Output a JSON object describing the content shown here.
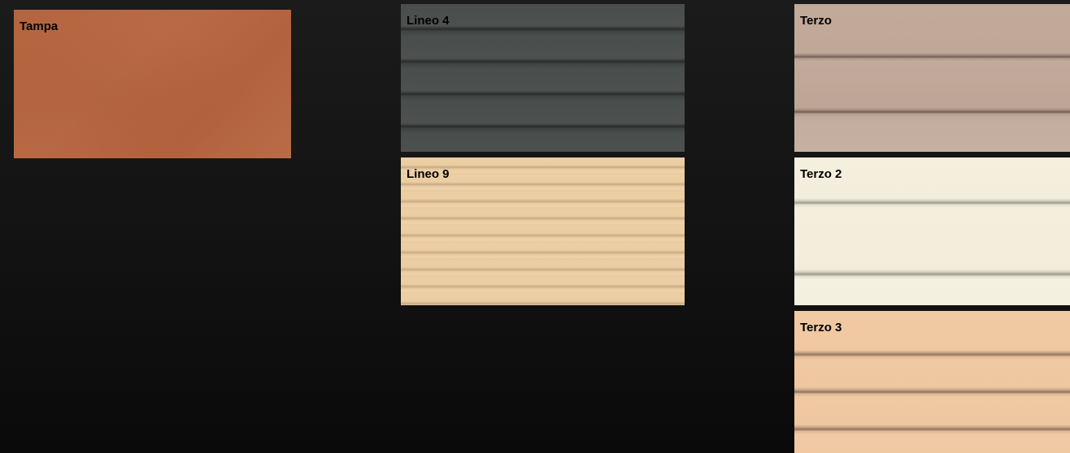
{
  "swatches": [
    {
      "label": "Tampa"
    },
    {
      "label": "Lineo 4"
    },
    {
      "label": "Lineo 9"
    },
    {
      "label": "Terzo"
    },
    {
      "label": "Terzo 2"
    },
    {
      "label": "Terzo 3"
    }
  ],
  "colors": {
    "background": "#131313",
    "tampa": "#b4653f",
    "lineo_4": "#4a4e4c",
    "lineo_9": "#edcfa5",
    "terzo": "#c2aa9a",
    "terzo_2": "#f5f0de",
    "terzo_3": "#f1caa4"
  }
}
